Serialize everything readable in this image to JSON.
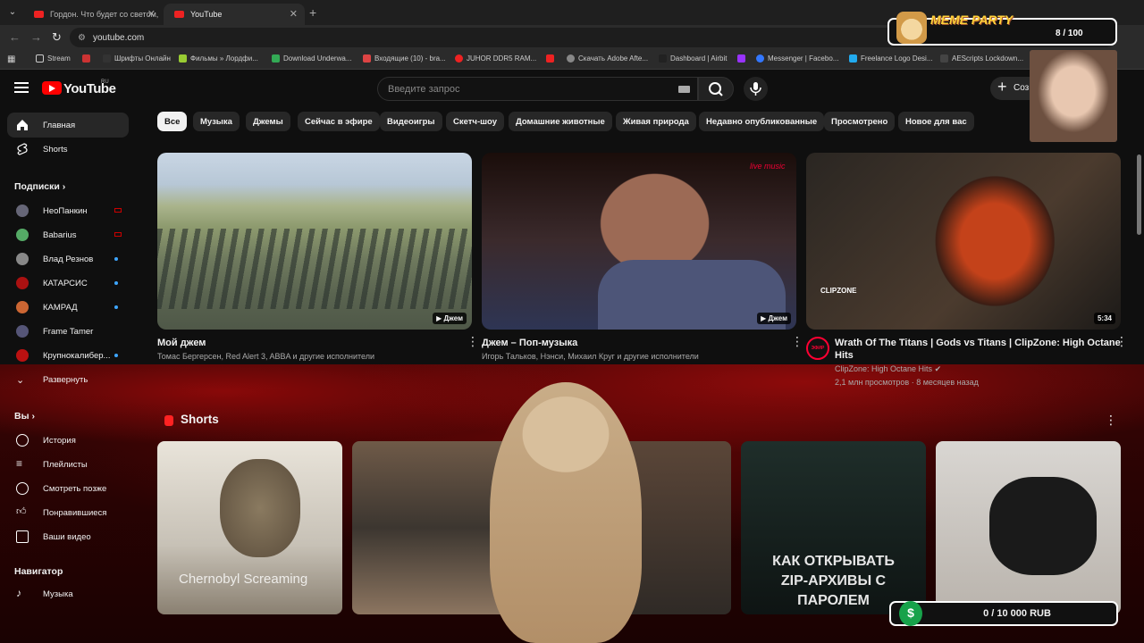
{
  "browser": {
    "tabs": [
      {
        "label": "Гордон. Что будет со светом, "
      },
      {
        "label": "YouTube"
      }
    ],
    "url": "youtube.com",
    "bookmarks": [
      "Stream",
      "",
      "Шрифты Онлайн",
      "Фильмы » Лордфи...",
      "Download Underwa...",
      "Входящие (10) - bra...",
      "JUHOR DDR5 RAM...",
      "",
      "Скачать Adobe Afte...",
      "Dashboard | Airbit",
      "",
      "Messenger | Facebo...",
      "Freelance Logo Desi...",
      "AEScripts Lockdown..."
    ]
  },
  "youtube": {
    "logo_text": "YouTube",
    "region": "RU",
    "search_placeholder": "Введите запрос",
    "create_label": "Соз",
    "sidebar": {
      "main": [
        {
          "label": "Главная"
        },
        {
          "label": "Shorts"
        }
      ],
      "subs_header": "Подписки",
      "subs": [
        {
          "label": "НеоПанкин"
        },
        {
          "label": "Babarius"
        },
        {
          "label": "Влад Резнов"
        },
        {
          "label": "КАТАРСИС"
        },
        {
          "label": "КАМРАД"
        },
        {
          "label": "Frame Tamer"
        },
        {
          "label": "Крупнокалибер..."
        },
        {
          "label": "Развернуть"
        }
      ],
      "you_header": "Вы",
      "you": [
        {
          "label": "История"
        },
        {
          "label": "Плейлисты"
        },
        {
          "label": "Смотреть позже"
        },
        {
          "label": "Понравившиеся"
        },
        {
          "label": "Ваши видео"
        }
      ],
      "nav_header": "Навигатор",
      "nav": [
        {
          "label": "Музыка"
        }
      ]
    },
    "chips": [
      "Все",
      "Музыка",
      "Джемы",
      "Сейчас в эфире",
      "Видеоигры",
      "Скетч-шоу",
      "Домашние животные",
      "Живая природа",
      "Недавно опубликованные",
      "Просмотрено",
      "Новое для вас"
    ],
    "videos": [
      {
        "title": "Мой джем",
        "meta": "Томас Бергерсен, Red Alert 3, ABBA и другие исполнители",
        "badge": "Джем"
      },
      {
        "title": "Джем – Поп-музыка",
        "meta": "Игорь Тальков, Нэнси, Михаил Круг и другие исполнители",
        "badge": "Джем",
        "overlay": "live music"
      },
      {
        "title1": "Wrath Of The Titans | Gods vs Titans | ClipZone: High Octane",
        "title2": "Hits",
        "channel": "ClipZone: High Octane Hits",
        "stats": "2,1 млн просмотров · 8 месяцев назад",
        "badge": "5:34",
        "overlay": "CLIPZONE",
        "live": "ЭФИР"
      }
    ],
    "shorts_header": "Shorts",
    "shorts": [
      {
        "caption": "Chernobyl Screaming"
      },
      {
        "caption": ""
      },
      {
        "caption": ""
      },
      {
        "caption": "КАК ОТКРЫВАТЬ ZIP-АРХИВЫ С ПАРОЛЕМ"
      },
      {
        "caption": ""
      }
    ]
  },
  "overlays": {
    "meme_label": "MEME PARTY",
    "meme_count": "8 / 100",
    "donate": "0 / 10 000 RUB",
    "donate_icon": "$"
  },
  "colors": {
    "accent": "#ff0000",
    "background": "#0f0f0f",
    "blood": "#3a0505"
  }
}
